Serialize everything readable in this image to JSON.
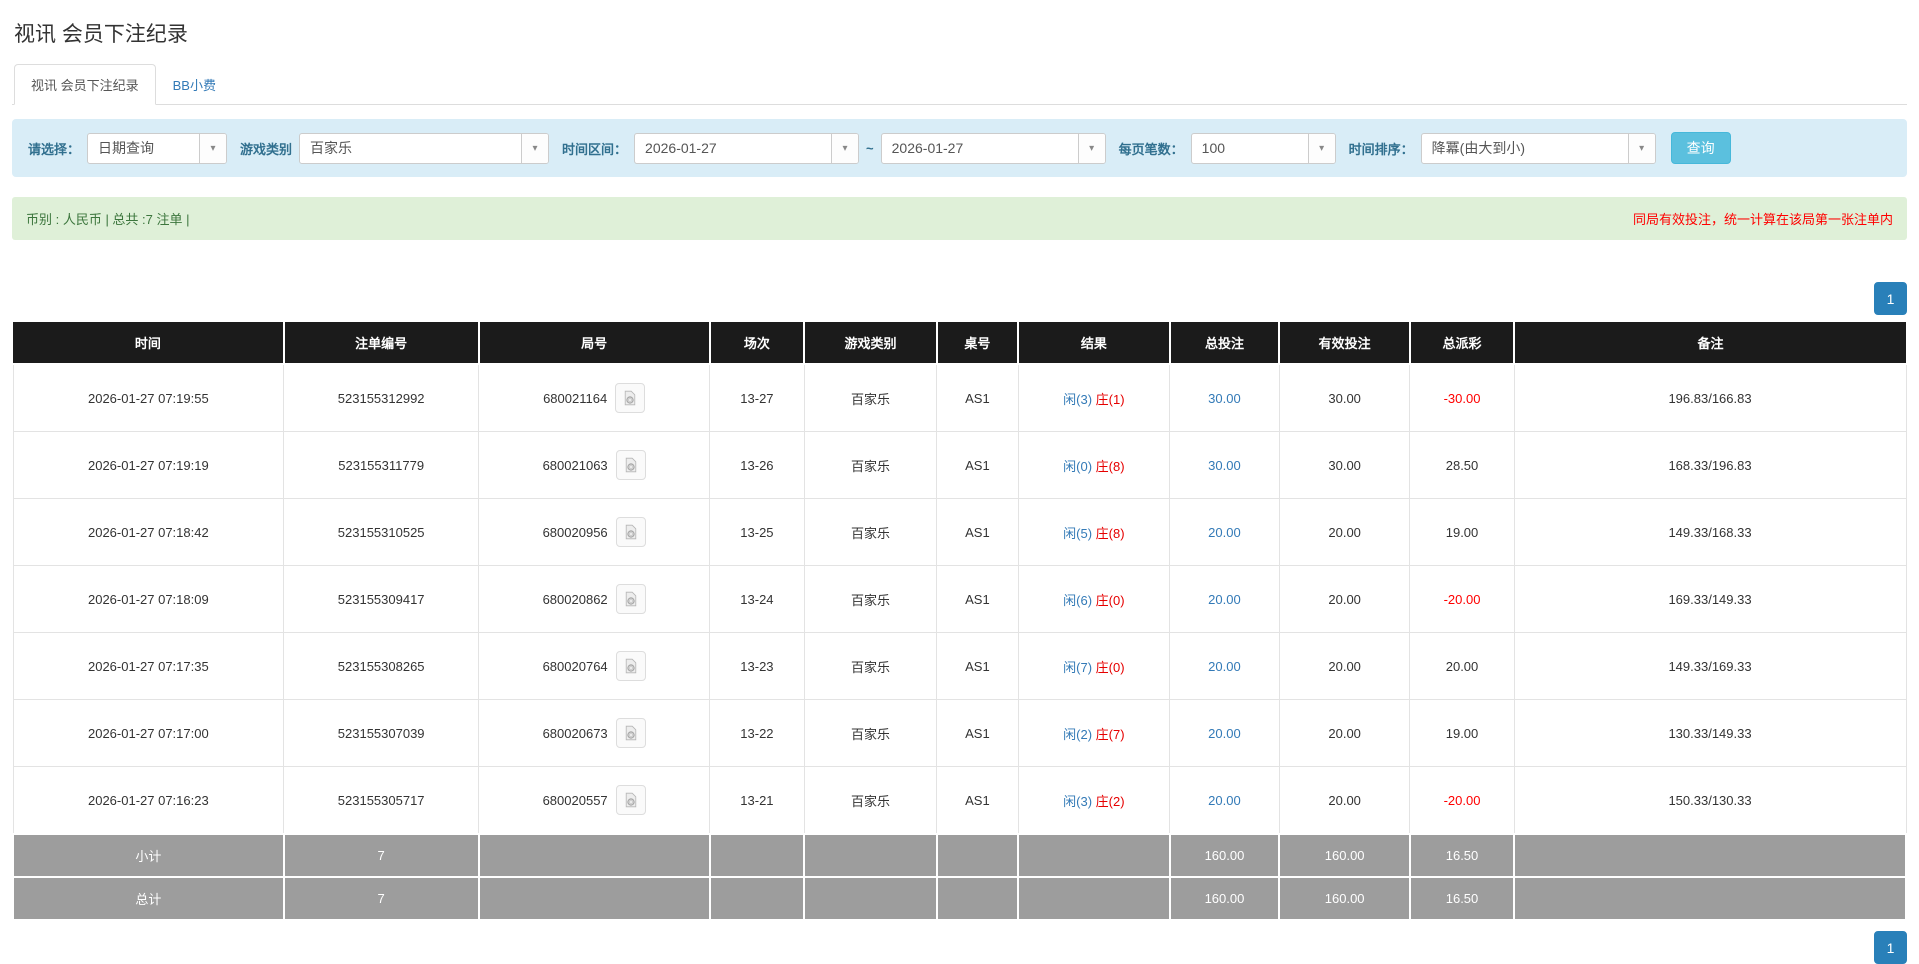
{
  "page": {
    "title": "视讯 会员下注纪录"
  },
  "tabs": [
    {
      "label": "视讯 会员下注纪录",
      "active": true
    },
    {
      "label": "BB小费",
      "active": false
    }
  ],
  "filters": {
    "select_type": {
      "label": "请选择：",
      "value": "日期查询"
    },
    "game_type": {
      "label": "游戏类别",
      "value": "百家乐"
    },
    "time_range": {
      "label": "时间区间：",
      "from": "2026-01-27",
      "separator": "~",
      "to": "2026-01-27"
    },
    "page_size": {
      "label": "每页笔数：",
      "value": "100"
    },
    "time_sort": {
      "label": "时间排序：",
      "value": "降冪(由大到小)"
    },
    "search_button_label": "查询"
  },
  "summary_bar": {
    "left": "币别 : 人民币 | 总共 :7 注单 |",
    "right": "同局有效投注，统一计算在该局第一张注单内"
  },
  "pagination": {
    "current_page": "1"
  },
  "icons": {
    "dropdown_caret": "▾",
    "video_replay": "video-file-icon"
  },
  "colors": {
    "accent_blue": "#337ab7",
    "pagination_blue": "#2980b9",
    "search_button": "#5bc0de",
    "filter_bg": "#d9edf7",
    "filter_label": "#31708f",
    "summary_bg": "#dff0d8",
    "summary_text": "#3c763d",
    "alert_red": "#ff0000",
    "banker_red": "#e60000",
    "header_bg": "#1b1b1b",
    "sum_row_bg": "#9d9d9d"
  },
  "table": {
    "headers": [
      "时间",
      "注单编号",
      "局号",
      "场次",
      "游戏类别",
      "桌号",
      "结果",
      "总投注",
      "有效投注",
      "总派彩",
      "备注"
    ],
    "rows": [
      {
        "time": "2026-01-27 07:19:55",
        "bet_id": "523155312992",
        "round_id": "680021164",
        "session": "13-27",
        "game_type": "百家乐",
        "table_no": "AS1",
        "result_player": "闲(3)",
        "result_banker": "庄(1)",
        "total_bet": "30.00",
        "valid_bet": "30.00",
        "payout": "-30.00",
        "remark": "196.83/166.83"
      },
      {
        "time": "2026-01-27 07:19:19",
        "bet_id": "523155311779",
        "round_id": "680021063",
        "session": "13-26",
        "game_type": "百家乐",
        "table_no": "AS1",
        "result_player": "闲(0)",
        "result_banker": "庄(8)",
        "total_bet": "30.00",
        "valid_bet": "30.00",
        "payout": "28.50",
        "remark": "168.33/196.83"
      },
      {
        "time": "2026-01-27 07:18:42",
        "bet_id": "523155310525",
        "round_id": "680020956",
        "session": "13-25",
        "game_type": "百家乐",
        "table_no": "AS1",
        "result_player": "闲(5)",
        "result_banker": "庄(8)",
        "total_bet": "20.00",
        "valid_bet": "20.00",
        "payout": "19.00",
        "remark": "149.33/168.33"
      },
      {
        "time": "2026-01-27 07:18:09",
        "bet_id": "523155309417",
        "round_id": "680020862",
        "session": "13-24",
        "game_type": "百家乐",
        "table_no": "AS1",
        "result_player": "闲(6)",
        "result_banker": "庄(0)",
        "total_bet": "20.00",
        "valid_bet": "20.00",
        "payout": "-20.00",
        "remark": "169.33/149.33"
      },
      {
        "time": "2026-01-27 07:17:35",
        "bet_id": "523155308265",
        "round_id": "680020764",
        "session": "13-23",
        "game_type": "百家乐",
        "table_no": "AS1",
        "result_player": "闲(7)",
        "result_banker": "庄(0)",
        "total_bet": "20.00",
        "valid_bet": "20.00",
        "payout": "20.00",
        "remark": "149.33/169.33"
      },
      {
        "time": "2026-01-27 07:17:00",
        "bet_id": "523155307039",
        "round_id": "680020673",
        "session": "13-22",
        "game_type": "百家乐",
        "table_no": "AS1",
        "result_player": "闲(2)",
        "result_banker": "庄(7)",
        "total_bet": "20.00",
        "valid_bet": "20.00",
        "payout": "19.00",
        "remark": "130.33/149.33"
      },
      {
        "time": "2026-01-27 07:16:23",
        "bet_id": "523155305717",
        "round_id": "680020557",
        "session": "13-21",
        "game_type": "百家乐",
        "table_no": "AS1",
        "result_player": "闲(3)",
        "result_banker": "庄(2)",
        "total_bet": "20.00",
        "valid_bet": "20.00",
        "payout": "-20.00",
        "remark": "150.33/130.33"
      }
    ],
    "subtotal": {
      "label": "小计",
      "count": "7",
      "total_bet": "160.00",
      "valid_bet": "160.00",
      "payout": "16.50"
    },
    "total": {
      "label": "总计",
      "count": "7",
      "total_bet": "160.00",
      "valid_bet": "160.00",
      "payout": "16.50"
    }
  }
}
